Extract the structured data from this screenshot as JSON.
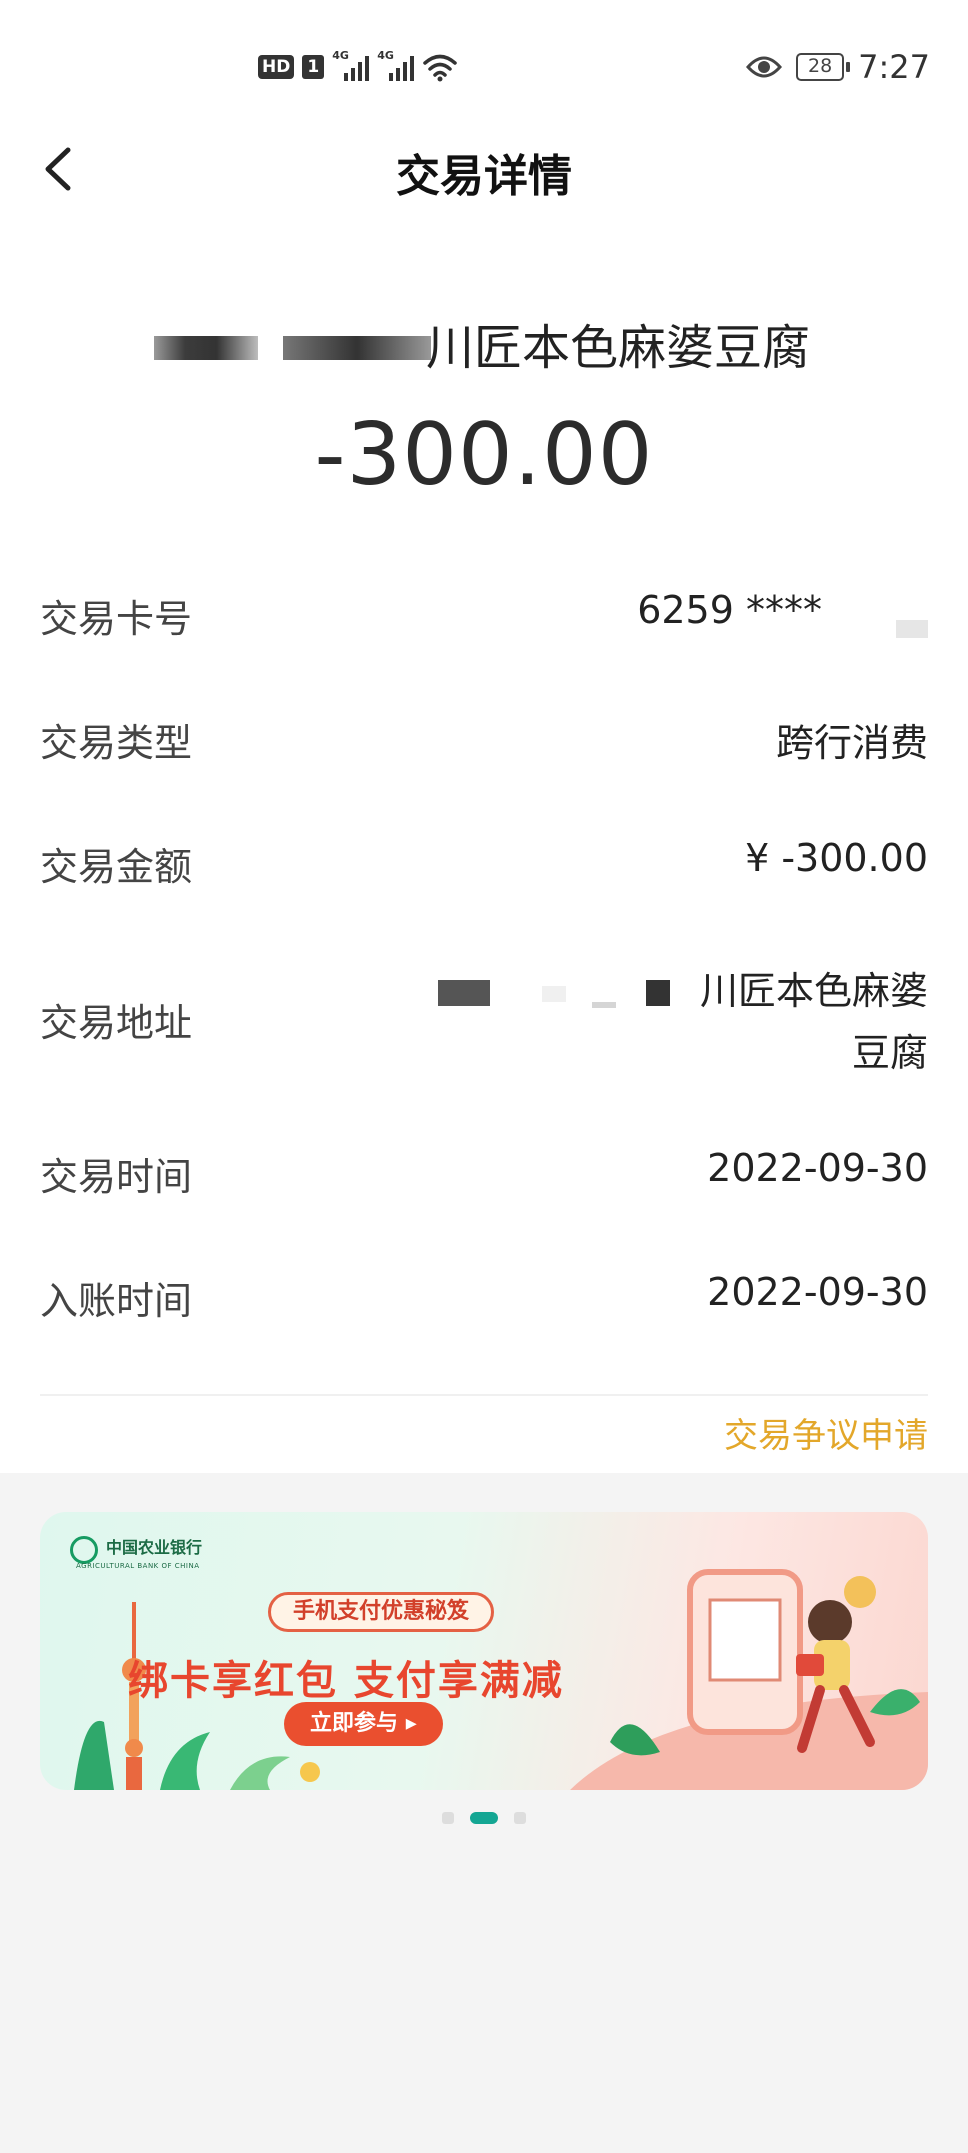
{
  "status_bar": {
    "hd": "HD",
    "sim": "1",
    "net1": "4G",
    "net2": "4G",
    "battery": "28",
    "time": "7:27"
  },
  "header": {
    "title": "交易详情"
  },
  "transaction": {
    "merchant_visible": "川匠本色麻婆豆腐",
    "amount": "-300.00"
  },
  "details": {
    "card_label": "交易卡号",
    "card_value": "6259 ****",
    "type_label": "交易类型",
    "type_value": "跨行消费",
    "amount_label": "交易金额",
    "amount_value": "¥ -300.00",
    "address_label": "交易地址",
    "address_line1": "川匠本色麻婆",
    "address_line2": "豆腐",
    "time_label": "交易时间",
    "time_value": "2022-09-30",
    "posted_label": "入账时间",
    "posted_value": "2022-09-30"
  },
  "dispute_link": "交易争议申请",
  "banner": {
    "bank_name": "中国农业银行",
    "bank_en": "AGRICULTURAL BANK OF CHINA",
    "tag": "手机支付优惠秘笈",
    "headline": "绑卡享红包 支付享满减",
    "cta": "立即参与",
    "cta_arrow": "▸"
  },
  "colors": {
    "accent": "#14a693",
    "dispute": "#e3a72a",
    "promo_red": "#e8462e"
  }
}
